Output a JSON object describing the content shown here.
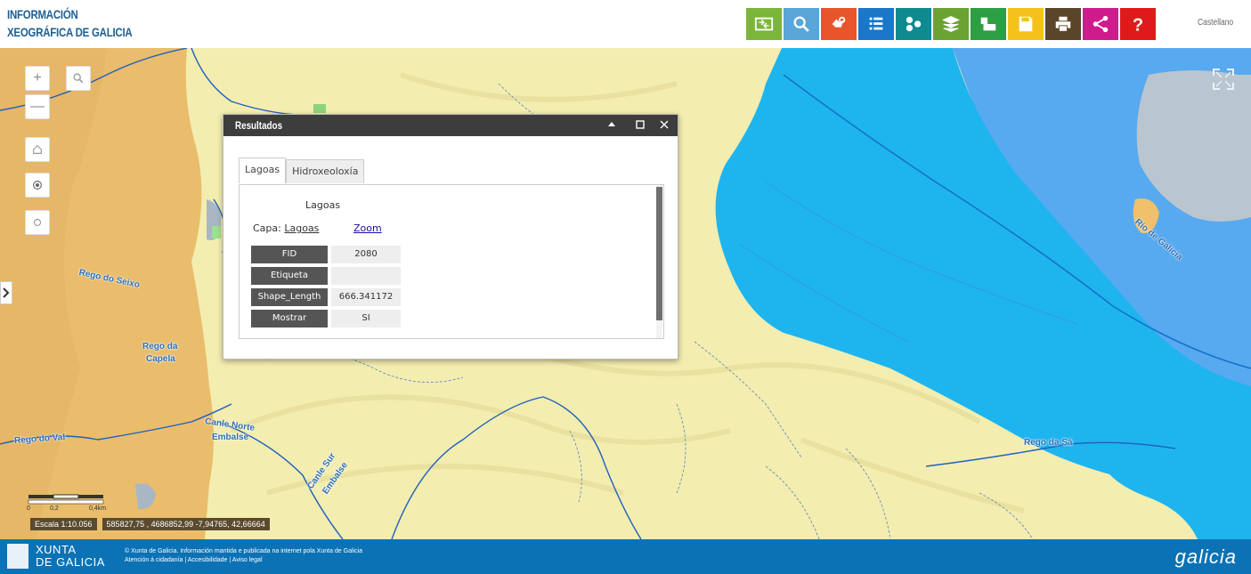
{
  "header": {
    "title_line1": "INFORMACIÓN",
    "title_line2": "XEOGRÁFICA DE GALICIA",
    "language": "Castellano"
  },
  "toolbar": [
    {
      "icon": "swap-map-icon",
      "color": "#7bb63a"
    },
    {
      "icon": "search-icon",
      "color": "#5aa6d8"
    },
    {
      "icon": "hand-info-icon",
      "color": "#e8552a"
    },
    {
      "icon": "list-icon",
      "color": "#1a77c9"
    },
    {
      "icon": "share-nodes-icon",
      "color": "#0f8a8f"
    },
    {
      "icon": "layers-icon",
      "color": "#6aa332"
    },
    {
      "icon": "map-pin-layers-icon",
      "color": "#2e9e44"
    },
    {
      "icon": "save-icon",
      "color": "#f4c21b"
    },
    {
      "icon": "print-icon",
      "color": "#5a4529"
    },
    {
      "icon": "share-icon",
      "color": "#d01b8c"
    },
    {
      "icon": "help-icon",
      "color": "#e01a1a"
    }
  ],
  "map_controls": {
    "zoom_in": "+",
    "zoom_out": "—"
  },
  "map_labels": {
    "rego_seixo": "Rego do Seixo",
    "rego_capela_1": "Rego da",
    "rego_capela_2": "Capela",
    "rego_val": "Rego do Val",
    "canle_norte_1": "Canle Norte",
    "canle_norte_2": "Embalse",
    "canle_sur_1": "Canle Sur",
    "canle_sur_2": "Embalse",
    "rego_sa": "Rego da Sá",
    "rio_galicia": "Río de Galicia"
  },
  "scale": {
    "ticks": [
      "0",
      "0,2",
      "0,4km"
    ],
    "scale_text": "Escala 1:10.056",
    "coords_text": "585827,75 , 4686852,99 -7,94765, 42,66664"
  },
  "dialog": {
    "title": "Resultados",
    "tabs": [
      "Lagoas",
      "Hidroxeoloxía"
    ],
    "layer_title": "Lagoas",
    "capa_label": "Capa:",
    "capa_value": "Lagoas",
    "zoom_link": "Zoom",
    "attributes": [
      {
        "key": "FID",
        "value": "2080"
      },
      {
        "key": "Etiqueta",
        "value": ""
      },
      {
        "key": "Shape_Length",
        "value": "666.341172"
      },
      {
        "key": "Mostrar",
        "value": "SI"
      }
    ]
  },
  "footer": {
    "xunta_line1": "XUNTA",
    "xunta_line2": "DE GALICIA",
    "info_line1": "© Xunta de Galicia. Información mantida e publicada na internet pola Xunta de Galicia",
    "info_line2": "Atención á cidadanía | Accesibilidade | Aviso legal",
    "brand": "galicia"
  }
}
